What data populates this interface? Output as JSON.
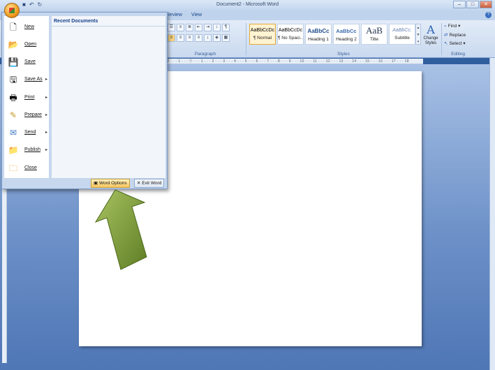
{
  "window": {
    "title": "Document2 - Microsoft Word"
  },
  "window_buttons": {
    "minimize": "–",
    "maximize": "□",
    "close": "✕"
  },
  "qat": {
    "save_icon": "save-icon",
    "undo": "↶",
    "redo": "↻"
  },
  "tabs": [
    {
      "label": "Review"
    },
    {
      "label": "View"
    }
  ],
  "help": {
    "label": "?"
  },
  "ribbon": {
    "paragraph_group": "Paragraph",
    "styles_group": "Styles",
    "editing_group": "Editing",
    "styles": [
      {
        "sample": "AaBbCcDc",
        "name": "¶ Normal",
        "active": true
      },
      {
        "sample": "AaBbCcDc",
        "name": "¶ No Spaci...",
        "active": false
      },
      {
        "sample": "AaBbCc",
        "name": "Heading 1",
        "active": false
      },
      {
        "sample": "AaBbCc",
        "name": "Heading 2",
        "active": false
      },
      {
        "sample": "AaB",
        "name": "Title",
        "active": false
      },
      {
        "sample": "AaBbCc.",
        "name": "Subtitle",
        "active": false
      }
    ],
    "change_styles": "Change Styles",
    "editing": {
      "find": "Find",
      "replace": "Replace",
      "select": "Select"
    }
  },
  "ruler": {
    "marks": "· 2 · · · 1 · · · ▽ · · · 1 · · · 2 · · · 3 · · · 4 · · · 5 · · · 6 · · · 7 · · · 8 · · · 9 · · · 10 · · · 11 · · · 12 · · · 13 · · · 14 · · · 15 · · · 16 · · · 17 · · · 18"
  },
  "office_menu": {
    "items": [
      {
        "label": "New",
        "icon": "new-document-icon",
        "has_submenu": false
      },
      {
        "label": "Open",
        "icon": "open-folder-icon",
        "has_submenu": false
      },
      {
        "label": "Save",
        "icon": "save-icon",
        "has_submenu": false
      },
      {
        "label": "Save As",
        "icon": "save-as-icon",
        "has_submenu": true
      },
      {
        "label": "Print",
        "icon": "printer-icon",
        "has_submenu": true
      },
      {
        "label": "Prepare",
        "icon": "prepare-icon",
        "has_submenu": true
      },
      {
        "label": "Send",
        "icon": "send-icon",
        "has_submenu": true
      },
      {
        "label": "Publish",
        "icon": "publish-icon",
        "has_submenu": true
      },
      {
        "label": "Close",
        "icon": "close-folder-icon",
        "has_submenu": false
      }
    ],
    "recent_documents_title": "Recent Documents",
    "word_options": "Word Options",
    "exit_word": "Exit Word"
  },
  "annotation": {
    "arrow_color": "#7f9b3a"
  }
}
